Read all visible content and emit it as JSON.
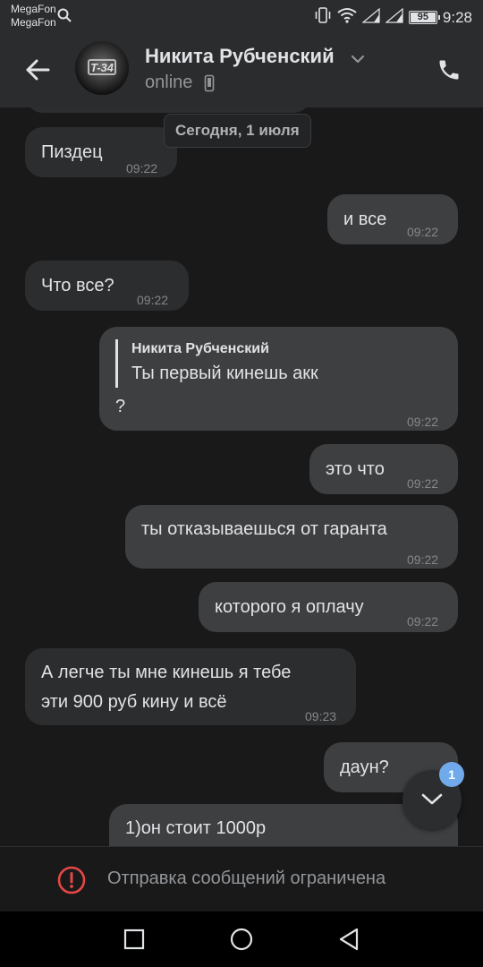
{
  "status_bar": {
    "carrier_1": "MegaFon",
    "carrier_2": "MegaFon",
    "battery": "95",
    "time": "9:28"
  },
  "header": {
    "name": "Никита Рубченский",
    "status": "online",
    "avatar_text": "T-34",
    "back_icon": "arrow-left-icon",
    "call_icon": "phone-icon"
  },
  "chat": {
    "date_label": "Сегодня, 1 июля",
    "messages": [
      {
        "dir": "in",
        "text": "Пиздец",
        "time": "09:22"
      },
      {
        "dir": "out",
        "text": "и все",
        "time": "09:22"
      },
      {
        "dir": "in",
        "text": "Что все?",
        "time": "09:22"
      },
      {
        "dir": "out",
        "reply_author": "Никита Рубченский",
        "reply_text": "Ты первый кинешь акк",
        "text": "?",
        "time": "09:22"
      },
      {
        "dir": "out",
        "text": "это что",
        "time": "09:22"
      },
      {
        "dir": "out",
        "text": "ты отказываешься от гаранта",
        "time": "09:22"
      },
      {
        "dir": "out",
        "text": "которого я оплачу",
        "time": "09:22"
      },
      {
        "dir": "in",
        "text_line1": "А легче ты мне кинешь я тебе",
        "text_line2": "эти 900 руб кину и всё",
        "time": "09:23"
      },
      {
        "dir": "out",
        "text": "даун?",
        "time": ""
      },
      {
        "dir": "out",
        "text": "1)он стоит 1000р",
        "time": ""
      }
    ],
    "unread_count": "1"
  },
  "footer": {
    "restriction_text": "Отправка сообщений ограничена"
  },
  "colors": {
    "background": "#19191a",
    "panel": "#2b2c2e",
    "bubble_in": "#2c2d2e",
    "bubble_out": "#3e3f41",
    "accent": "#71aaeb",
    "warning": "#e64646"
  }
}
